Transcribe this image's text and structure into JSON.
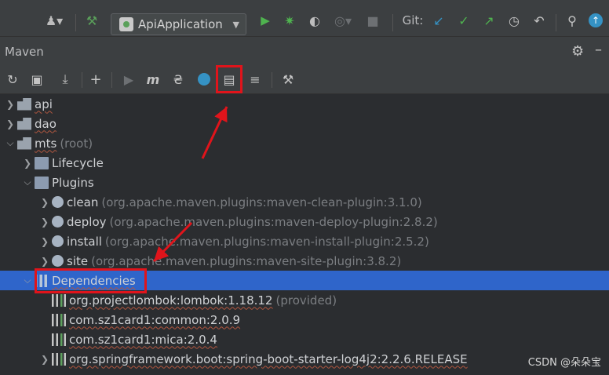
{
  "toolbar": {
    "run_config": "ApiApplication",
    "git_label": "Git:"
  },
  "maven": {
    "title": "Maven"
  },
  "tree": [
    {
      "label": "api",
      "muted": "",
      "indent": 0,
      "arrow": "right",
      "icon": "module-icon"
    },
    {
      "label": "dao",
      "muted": "",
      "indent": 0,
      "arrow": "right",
      "icon": "module-icon"
    },
    {
      "label": "mts",
      "muted": "(root)",
      "indent": 0,
      "arrow": "down",
      "icon": "module-icon"
    },
    {
      "label": "Lifecycle",
      "muted": "",
      "indent": 1,
      "arrow": "right",
      "icon": "folder-icon"
    },
    {
      "label": "Plugins",
      "muted": "",
      "indent": 1,
      "arrow": "down",
      "icon": "folder-icon"
    },
    {
      "label": "clean",
      "muted": "(org.apache.maven.plugins:maven-clean-plugin:3.1.0)",
      "indent": 2,
      "arrow": "right",
      "icon": "plugin-icon"
    },
    {
      "label": "deploy",
      "muted": "(org.apache.maven.plugins:maven-deploy-plugin:2.8.2)",
      "indent": 2,
      "arrow": "right",
      "icon": "plugin-icon"
    },
    {
      "label": "install",
      "muted": "(org.apache.maven.plugins:maven-install-plugin:2.5.2)",
      "indent": 2,
      "arrow": "right",
      "icon": "plugin-icon"
    },
    {
      "label": "site",
      "muted": "(org.apache.maven.plugins:maven-site-plugin:3.8.2)",
      "indent": 2,
      "arrow": "right",
      "icon": "plugin-icon"
    },
    {
      "label": "Dependencies",
      "muted": "",
      "indent": 1,
      "arrow": "down",
      "icon": "dependencies-icon",
      "selected": true
    },
    {
      "label": "org.projectlombok:lombok:1.18.12",
      "muted": "(provided)",
      "indent": 2,
      "arrow": "none",
      "icon": "library-icon"
    },
    {
      "label": "com.sz1card1:common:2.0.9",
      "muted": "",
      "indent": 2,
      "arrow": "none",
      "icon": "library-icon"
    },
    {
      "label": "com.sz1card1:mica:2.0.4",
      "muted": "",
      "indent": 2,
      "arrow": "none",
      "icon": "library-icon"
    },
    {
      "label": "org.springframework.boot:spring-boot-starter-log4j2:2.2.6.RELEASE",
      "muted": "",
      "indent": 2,
      "arrow": "right",
      "icon": "library-icon"
    }
  ],
  "watermark": "CSDN @朵朵宝",
  "colors": {
    "selection": "#2f65ca",
    "highlight_box": "#e0141b",
    "run_green": "#4fb34f",
    "accent_blue": "#3592c4"
  }
}
